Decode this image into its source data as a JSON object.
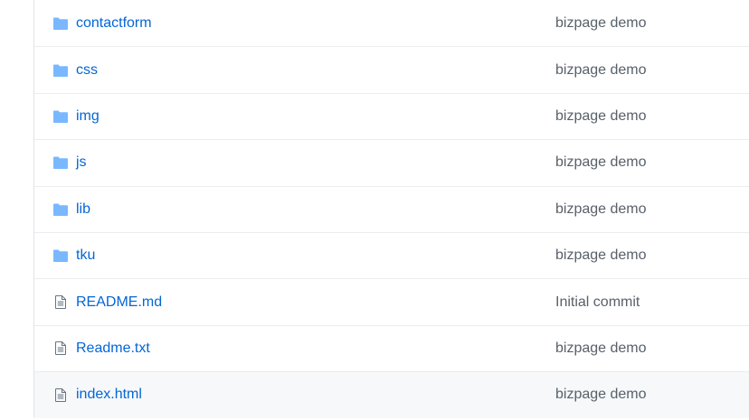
{
  "files": [
    {
      "type": "dir",
      "icon": "folder-icon",
      "name": "contactform",
      "message": "bizpage demo"
    },
    {
      "type": "dir",
      "icon": "folder-icon",
      "name": "css",
      "message": "bizpage demo"
    },
    {
      "type": "dir",
      "icon": "folder-icon",
      "name": "img",
      "message": "bizpage demo"
    },
    {
      "type": "dir",
      "icon": "folder-icon",
      "name": "js",
      "message": "bizpage demo"
    },
    {
      "type": "dir",
      "icon": "folder-icon",
      "name": "lib",
      "message": "bizpage demo"
    },
    {
      "type": "dir",
      "icon": "folder-icon",
      "name": "tku",
      "message": "bizpage demo"
    },
    {
      "type": "file",
      "icon": "file-icon",
      "name": "README.md",
      "message": "Initial commit"
    },
    {
      "type": "file",
      "icon": "file-icon",
      "name": "Readme.txt",
      "message": "bizpage demo"
    },
    {
      "type": "file",
      "icon": "file-icon",
      "name": "index.html",
      "message": "bizpage demo",
      "hovered": true
    }
  ],
  "colors": {
    "folder": "#79b8ff",
    "file_icon": "#6a737d",
    "link": "#0366d6",
    "message": "#586069",
    "hover_bg": "#f6f8fa"
  }
}
